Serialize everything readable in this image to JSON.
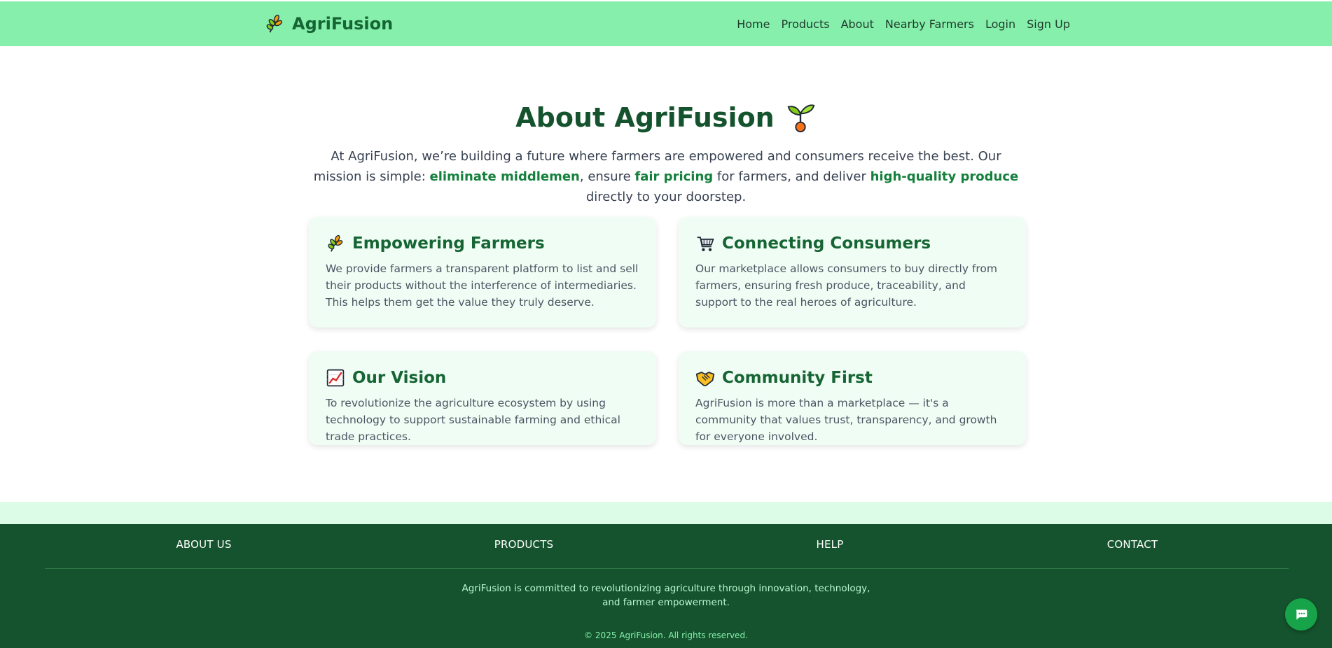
{
  "header": {
    "brand_name": "AgriFusion",
    "brand_icon": "wheat-icon",
    "nav": [
      {
        "label": "Home"
      },
      {
        "label": "Products"
      },
      {
        "label": "About"
      },
      {
        "label": "Nearby Farmers"
      },
      {
        "label": "Login"
      },
      {
        "label": "Sign Up"
      }
    ]
  },
  "main": {
    "title": "About AgriFusion",
    "title_icon": "seedling-icon",
    "intro": {
      "part1": "At AgriFusion, we’re building a future where farmers are empowered and consumers receive the best. Our mission is simple: ",
      "hl1": "eliminate middlemen",
      "part2": ", ensure ",
      "hl2": "fair pricing",
      "part3": " for farmers, and deliver ",
      "hl3": "high-quality produce",
      "part4": " directly to your doorstep."
    },
    "cards": [
      {
        "icon": "wheat-icon",
        "title": "Empowering Farmers",
        "text": "We provide farmers a transparent platform to list and sell their products without the interference of intermediaries. This helps them get the value they truly deserve."
      },
      {
        "icon": "shopping-cart-icon",
        "title": "Connecting Consumers",
        "text": "Our marketplace allows consumers to buy directly from farmers, ensuring fresh produce, traceability, and support to the real heroes of agriculture."
      },
      {
        "icon": "chart-up-icon",
        "title": "Our Vision",
        "text": "To revolutionize the agriculture ecosystem by using technology to support sustainable farming and ethical trade practices."
      },
      {
        "icon": "handshake-icon",
        "title": "Community First",
        "text": "AgriFusion is more than a marketplace — it's a community that values trust, transparency, and growth for everyone involved."
      }
    ]
  },
  "footer": {
    "links": [
      {
        "label": "ABOUT US"
      },
      {
        "label": "PRODUCTS"
      },
      {
        "label": "HELP"
      },
      {
        "label": "CONTACT"
      }
    ],
    "description_line1": "AgriFusion is committed to revolutionizing agriculture through innovation, technology,",
    "description_line2": "and farmer empowerment.",
    "copyright": "© 2025 AgriFusion. All rights reserved."
  },
  "chat_icon": "chat-bubble-icon",
  "colors": {
    "nav_bg": "#86efac",
    "brand": "#166534",
    "title": "#14532d",
    "highlight": "#15803d",
    "card_bg": "#f0fdf4",
    "footer_bg": "#14532d",
    "footer_band": "#dcfce7",
    "chat_button": "#16a34a"
  }
}
